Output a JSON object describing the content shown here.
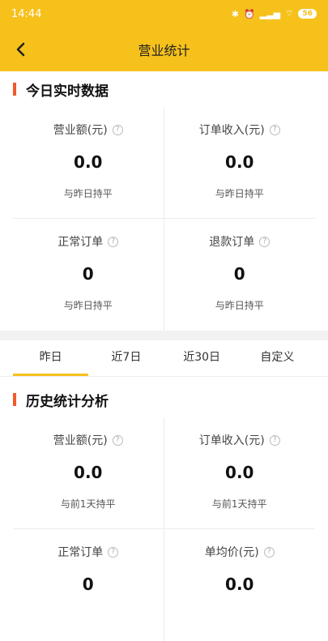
{
  "status": {
    "time": "14:44",
    "signal_text": "..Ill Ill",
    "battery": "56"
  },
  "nav": {
    "title": "营业统计"
  },
  "realtime": {
    "title": "今日实时数据",
    "stats": [
      {
        "label": "营业额(元)",
        "value": "0.0",
        "compare": "与昨日持平"
      },
      {
        "label": "订单收入(元)",
        "value": "0.0",
        "compare": "与昨日持平"
      },
      {
        "label": "正常订单",
        "value": "0",
        "compare": "与昨日持平"
      },
      {
        "label": "退款订单",
        "value": "0",
        "compare": "与昨日持平"
      }
    ]
  },
  "tabs": [
    {
      "label": "昨日",
      "active": true
    },
    {
      "label": "近7日",
      "active": false
    },
    {
      "label": "近30日",
      "active": false
    },
    {
      "label": "自定义",
      "active": false
    }
  ],
  "history": {
    "title": "历史统计分析",
    "stats": [
      {
        "label": "营业额(元)",
        "value": "0.0",
        "compare": "与前1天持平"
      },
      {
        "label": "订单收入(元)",
        "value": "0.0",
        "compare": "与前1天持平"
      },
      {
        "label": "正常订单",
        "value": "0",
        "compare": ""
      },
      {
        "label": "单均价(元)",
        "value": "0.0",
        "compare": ""
      }
    ]
  },
  "help_glyph": "?",
  "colors": {
    "brand": "#f6c11b",
    "accent": "#f2592a"
  }
}
